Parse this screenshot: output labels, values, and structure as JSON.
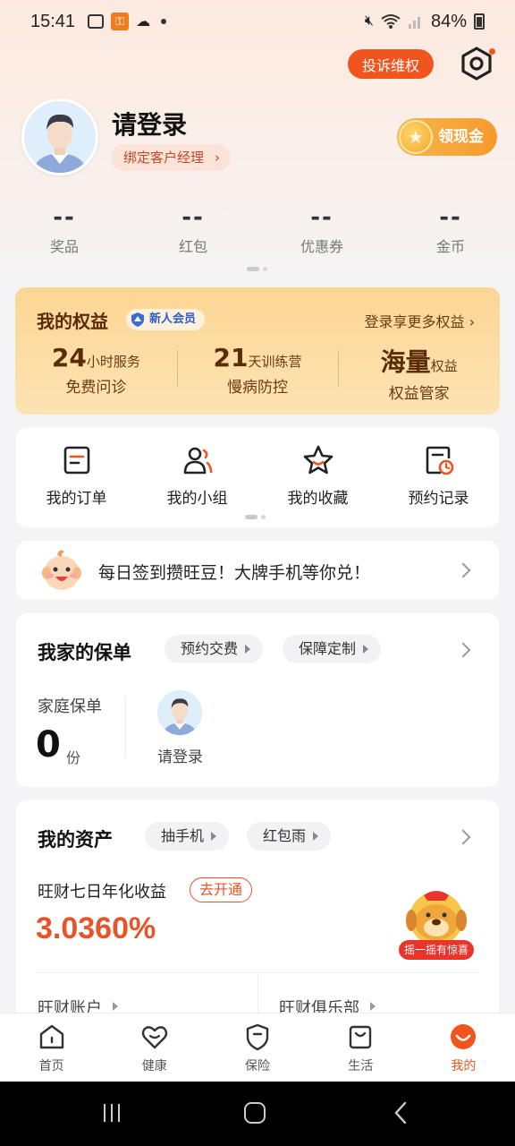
{
  "status_bar": {
    "time": "15:41",
    "battery": "84%"
  },
  "header": {
    "complaint_label": "投诉维权",
    "login_title": "请登录",
    "bind_manager_label": "绑定客户经理",
    "cash_label": "领现金"
  },
  "stats": [
    {
      "value": "--",
      "label": "奖品"
    },
    {
      "value": "--",
      "label": "红包"
    },
    {
      "value": "--",
      "label": "优惠券"
    },
    {
      "value": "--",
      "label": "金币"
    }
  ],
  "benefits": {
    "title": "我的权益",
    "badge": "新人会员",
    "more": "登录享更多权益",
    "items": [
      {
        "big": "24",
        "unit": "小时服务",
        "sub": "免费问诊"
      },
      {
        "big": "21",
        "unit": "天训练营",
        "sub": "慢病防控"
      },
      {
        "big": "海量",
        "unit": "权益",
        "sub": "权益管家"
      }
    ]
  },
  "quick_actions": [
    {
      "label": "我的订单",
      "icon": "order-icon"
    },
    {
      "label": "我的小组",
      "icon": "group-icon"
    },
    {
      "label": "我的收藏",
      "icon": "star-icon"
    },
    {
      "label": "预约记录",
      "icon": "appointment-icon"
    }
  ],
  "signin_banner": {
    "text": "每日签到攒旺豆！大牌手机等你兑！"
  },
  "policy": {
    "title": "我家的保单",
    "pills": [
      "预约交费",
      "保障定制"
    ],
    "family_label": "家庭保单",
    "count": "0",
    "unit": "份",
    "member_label": "请登录"
  },
  "assets": {
    "title": "我的资产",
    "pills": [
      "抽手机",
      "红包雨"
    ],
    "yield_label": "旺财七日年化收益",
    "open_label": "去开通",
    "rate": "3.0360%",
    "shake_label": "摇一摇有惊喜",
    "accounts": [
      "旺财账户",
      "旺财俱乐部"
    ]
  },
  "tabbar": [
    {
      "label": "首页",
      "icon": "home-icon"
    },
    {
      "label": "健康",
      "icon": "heart-icon"
    },
    {
      "label": "保险",
      "icon": "shield-icon"
    },
    {
      "label": "生活",
      "icon": "bag-icon"
    },
    {
      "label": "我的",
      "icon": "me-icon",
      "active": true
    }
  ],
  "colors": {
    "accent": "#f2541e",
    "gold": "#fcd693"
  }
}
